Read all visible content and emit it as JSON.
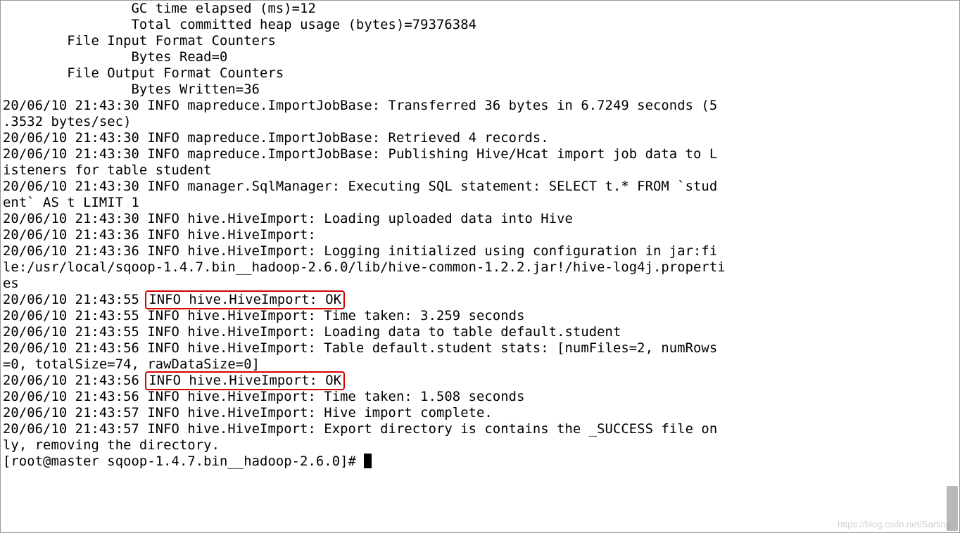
{
  "lines": {
    "l0": "                GC time elapsed (ms)=12",
    "l1": "                Total committed heap usage (bytes)=79376384",
    "l2": "        File Input Format Counters",
    "l3": "                Bytes Read=0",
    "l4": "        File Output Format Counters",
    "l5": "                Bytes Written=36",
    "l6": "20/06/10 21:43:30 INFO mapreduce.ImportJobBase: Transferred 36 bytes in 6.7249 seconds (5",
    "l7": ".3532 bytes/sec)",
    "l8": "20/06/10 21:43:30 INFO mapreduce.ImportJobBase: Retrieved 4 records.",
    "l9": "20/06/10 21:43:30 INFO mapreduce.ImportJobBase: Publishing Hive/Hcat import job data to L",
    "l10": "isteners for table student",
    "l11": "20/06/10 21:43:30 INFO manager.SqlManager: Executing SQL statement: SELECT t.* FROM `stud",
    "l12": "ent` AS t LIMIT 1",
    "l13": "20/06/10 21:43:30 INFO hive.HiveImport: Loading uploaded data into Hive",
    "l14": "20/06/10 21:43:36 INFO hive.HiveImport:",
    "l15": "20/06/10 21:43:36 INFO hive.HiveImport: Logging initialized using configuration in jar:fi",
    "l16": "le:/usr/local/sqoop-1.4.7.bin__hadoop-2.6.0/lib/hive-common-1.2.2.jar!/hive-log4j.properti",
    "l17": "es",
    "l18a": "20/06/10 21:43:55 ",
    "l18b": "INFO hive.HiveImport: OK",
    "l19": "20/06/10 21:43:55 INFO hive.HiveImport: Time taken: 3.259 seconds",
    "l20": "20/06/10 21:43:55 INFO hive.HiveImport: Loading data to table default.student",
    "l21": "20/06/10 21:43:56 INFO hive.HiveImport: Table default.student stats: [numFiles=2, numRows",
    "l22": "=0, totalSize=74, rawDataSize=0]",
    "l23a": "20/06/10 21:43:56 ",
    "l23b": "INFO hive.HiveImport: OK",
    "l24": "20/06/10 21:43:56 INFO hive.HiveImport: Time taken: 1.508 seconds",
    "l25": "20/06/10 21:43:57 INFO hive.HiveImport: Hive import complete.",
    "l26": "20/06/10 21:43:57 INFO hive.HiveImport: Export directory is contains the _SUCCESS file on",
    "l27": "ly, removing the directory.",
    "l28": "[root@master sqoop-1.4.7.bin__hadoop-2.6.0]# "
  },
  "watermark": "https://blog.csdn.net/Sarting"
}
